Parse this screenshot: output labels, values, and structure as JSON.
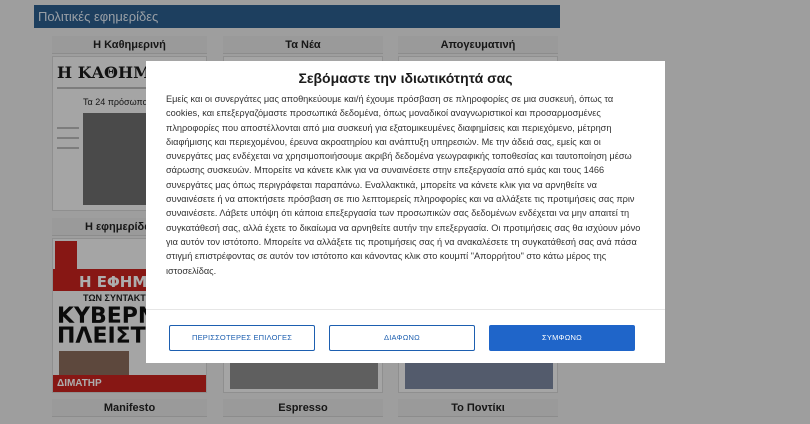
{
  "section": {
    "title": "Πολιτικές εφημερίδες"
  },
  "columns_top": [
    "Η Καθημερινή",
    "Τα Νέα",
    "Απογευματινή"
  ],
  "columns_mid": [
    "Η εφημερίδα των"
  ],
  "columns_bottom": [
    "Manifesto",
    "Espresso",
    "Το Ποντίκι"
  ],
  "thumbs": {
    "kathimerini_mast": "Η ΚΑΘΗΜ",
    "kathimerini_sub": "Τα 24 πρόσωπα τ",
    "efsyn_mast": "Η ΕΦΗΜΕ",
    "efsyn_sub": "ΤΩΝ ΣΥΝΤΑΚΤ",
    "efsyn_headline_1": "ΚΥΒΕΡΝΗΣΗ",
    "efsyn_headline_2": "ΠΛΕΙΣΤΗΡΙΑΣΜ",
    "efsyn_footer": "ΔΙΜΑΤΗΡ"
  },
  "consent": {
    "title": "Σεβόμαστε την ιδιωτικότητά σας",
    "body": "Εμείς και οι συνεργάτες μας αποθηκεύουμε και/ή έχουμε πρόσβαση σε πληροφορίες σε μια συσκευή, όπως τα cookies, και επεξεργαζόμαστε προσωπικά δεδομένα, όπως μοναδικοί αναγνωριστικοί και προσαρμοσμένες πληροφορίες που αποστέλλονται από μια συσκευή για εξατομικευμένες διαφημίσεις και περιεχόμενο, μέτρηση διαφήμισης και περιεχομένου, έρευνα ακροατηρίου και ανάπτυξη υπηρεσιών. Με την άδειά σας, εμείς και οι συνεργάτες μας ενδέχεται να χρησιμοποιήσουμε ακριβή δεδομένα γεωγραφικής τοποθεσίας και ταυτοποίηση μέσω σάρωσης συσκευών. Μπορείτε να κάνετε κλικ για να συναινέσετε στην επεξεργασία από εμάς και τους 1466 συνεργάτες μας όπως περιγράφεται παραπάνω. Εναλλακτικά, μπορείτε να κάνετε κλικ για να αρνηθείτε να συναινέσετε ή να αποκτήσετε πρόσβαση σε πιο λεπτομερείς πληροφορίες και να αλλάξετε τις προτιμήσεις σας πριν συναινέσετε. Λάβετε υπόψη ότι κάποια επεξεργασία των προσωπικών σας δεδομένων ενδέχεται να μην απαιτεί τη συγκατάθεσή σας, αλλά έχετε το δικαίωμα να αρνηθείτε αυτήν την επεξεργασία. Οι προτιμήσεις σας θα ισχύουν μόνο για αυτόν τον ιστότοπο. Μπορείτε να αλλάξετε τις προτιμήσεις σας ή να ανακαλέσετε τη συγκατάθεσή σας ανά πάσα στιγμή επιστρέφοντας σε αυτόν τον ιστότοπο και κάνοντας κλικ στο κουμπί \"Απορρήτου\" στο κάτω μέρος της ιστοσελίδας.",
    "more_options": "ΠΕΡΙΣΣΟΤΕΡΕΣ ΕΠΙΛΟΓΕΣ",
    "disagree": "ΔΙΑΦΩΝΩ",
    "agree": "ΣΥΜΦΩΝΩ"
  }
}
